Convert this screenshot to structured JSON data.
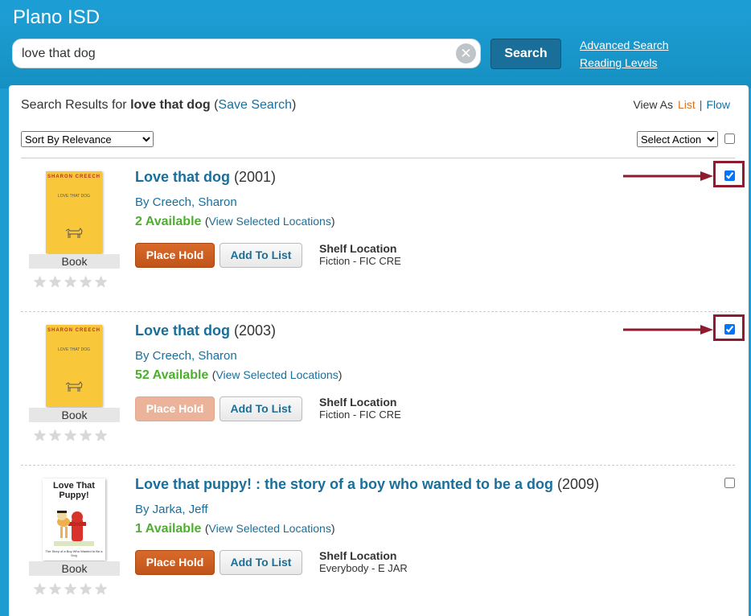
{
  "header": {
    "brand": "Plano ISD",
    "search_value": "love that dog",
    "search_button": "Search",
    "advanced_search": "Advanced Search",
    "reading_levels": "Reading Levels"
  },
  "results": {
    "prefix": "Search Results for ",
    "query": "love that dog",
    "open_paren": " (",
    "save_search": "Save Search",
    "close_paren": ")",
    "view_as": "View As",
    "view_list": "List",
    "view_sep": "|",
    "view_flow": "Flow",
    "sort_option": "Sort By Relevance",
    "action_option": "Select Action"
  },
  "items": [
    {
      "cover_author": "SHARON CREECH",
      "cover_title": "LOVE THAT DOG",
      "title": "Love that dog",
      "year": "(2001)",
      "author": "By Creech, Sharon",
      "available": "2 Available",
      "locations_open": "(",
      "locations_link": "View Selected Locations",
      "locations_close": ")",
      "format": "Book",
      "stars": "★★★★★",
      "hold": "Place Hold",
      "add_list": "Add To List",
      "shelf_label": "Shelf Location",
      "shelf_value": "Fiction - FIC CRE",
      "selected": true
    },
    {
      "cover_author": "SHARON CREECH",
      "cover_title": "LOVE THAT DOG",
      "title": "Love that dog",
      "year": "(2003)",
      "author": "By Creech, Sharon",
      "available": "52 Available",
      "locations_open": "(",
      "locations_link": "View Selected Locations",
      "locations_close": ")",
      "format": "Book",
      "stars": "★★★★★",
      "hold": "Place Hold",
      "add_list": "Add To List",
      "shelf_label": "Shelf Location",
      "shelf_value": "Fiction - FIC CRE",
      "selected": true
    },
    {
      "cover_title": "Love That Puppy!",
      "cover_subtitle": "The Story of a Boy Who Wanted to Be a Dog",
      "title": "Love that puppy! : the story of a boy who wanted to be a dog",
      "year": "(2009)",
      "author": "By Jarka, Jeff",
      "available": "1 Available",
      "locations_open": "(",
      "locations_link": "View Selected Locations",
      "locations_close": ")",
      "format": "Book",
      "stars": "★★★★★",
      "hold": "Place Hold",
      "add_list": "Add To List",
      "shelf_label": "Shelf Location",
      "shelf_value": "Everybody - E JAR",
      "selected": false
    }
  ],
  "colors": {
    "header_blue": "#1d9fd6",
    "link_blue": "#1a6f9a",
    "available_green": "#4caf2e",
    "hold_orange": "#c85d20",
    "highlight_red": "#8e1b2e"
  }
}
